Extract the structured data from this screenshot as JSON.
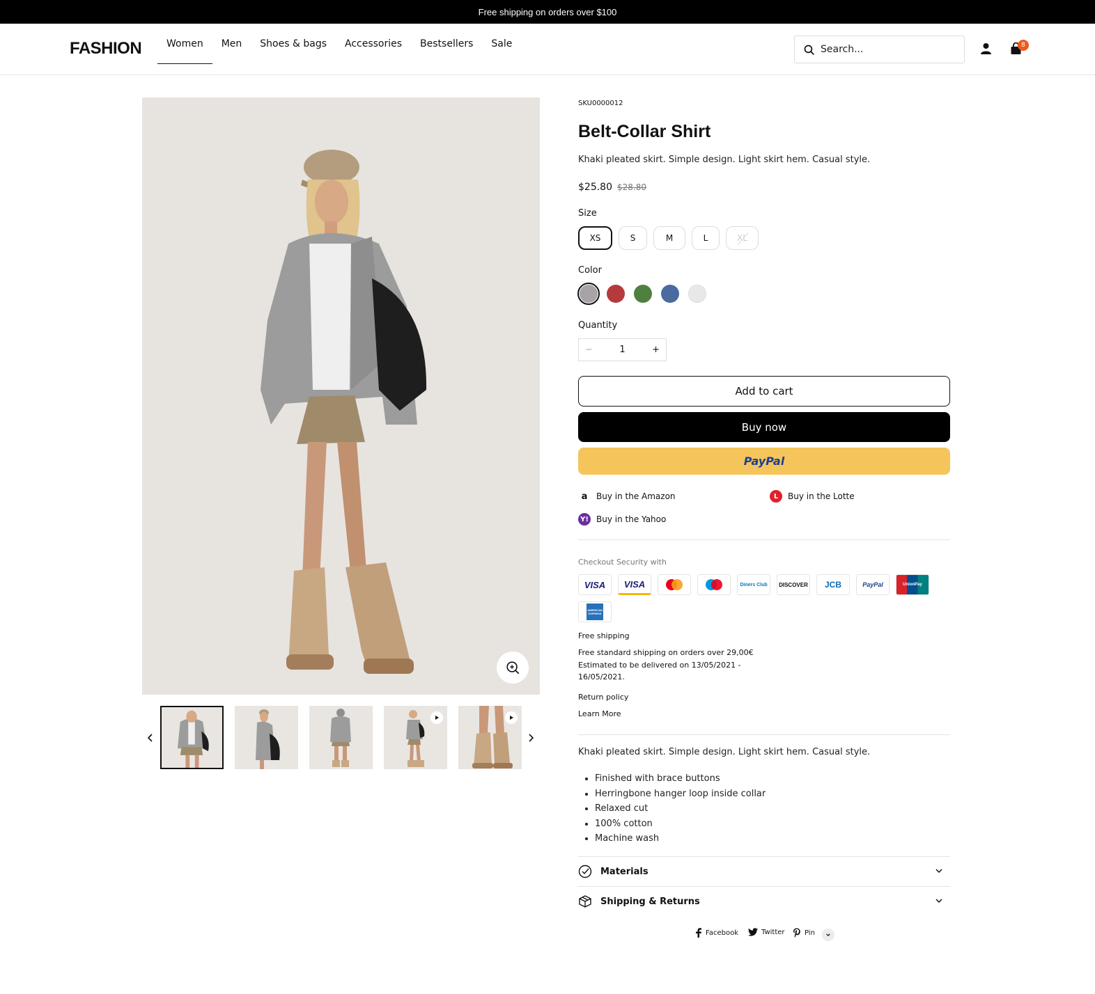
{
  "announcement": "Free shipping on orders over $100",
  "header": {
    "logo": "FASHION",
    "nav": [
      "Women",
      "Men",
      "Shoes & bags",
      "Accessories",
      "Bestsellers",
      "Sale"
    ],
    "active_nav": "Women",
    "search_placeholder": "Search...",
    "cart_count": "8"
  },
  "product": {
    "sku": "SKU0000012",
    "title": "Belt-Collar Shirt",
    "short_description": "Khaki pleated skirt. Simple design. Light skirt hem. Casual style.",
    "price": "$25.80",
    "compare_price": "$28.80",
    "size_label": "Size",
    "sizes": [
      "XS",
      "S",
      "M",
      "L",
      "XL"
    ],
    "selected_size": "XS",
    "unavailable_size": "XL",
    "color_label": "Color",
    "colors": [
      "#a8a3a6",
      "#b53a3d",
      "#4f8040",
      "#4a6aa0",
      "#e8e8e8"
    ],
    "quantity_label": "Quantity",
    "quantity": "1",
    "add_to_cart": "Add to cart",
    "buy_now": "Buy now",
    "paypal": "PayPal",
    "marketplaces": [
      "Buy in the Amazon",
      "Buy in the Lotte",
      "Buy in the Yahoo"
    ],
    "security_label": "Checkout Security with",
    "payment_methods": [
      "VISA",
      "VISA",
      "mastercard",
      "maestro",
      "Diners Club",
      "DISCOVER",
      "JCB",
      "PayPal",
      "UnionPay",
      "AMERICAN EXPRESS"
    ],
    "free_shipping_title": "Free shipping",
    "free_shipping_text_1": "Free standard shipping on orders over 29,00€",
    "free_shipping_text_2": "Estimated to be delivered on 13/05/2021 -",
    "free_shipping_text_3": "16/05/2021.",
    "return_policy": "Return policy",
    "learn_more": "Learn More",
    "long_description": "Khaki pleated skirt. Simple design. Light skirt hem. Casual style.",
    "features": [
      "Finished with brace buttons",
      "Herringbone hanger loop inside collar",
      "Relaxed cut",
      "100% cotton",
      "Machine wash"
    ],
    "accordions": [
      "Materials",
      "Shipping & Returns"
    ],
    "share": [
      "Facebook",
      "Twitter",
      "Pin"
    ]
  },
  "colors": {
    "accent": "#f05a1a",
    "paypal_button": "#f5c55c",
    "image_bg": "#e7e4e0"
  }
}
